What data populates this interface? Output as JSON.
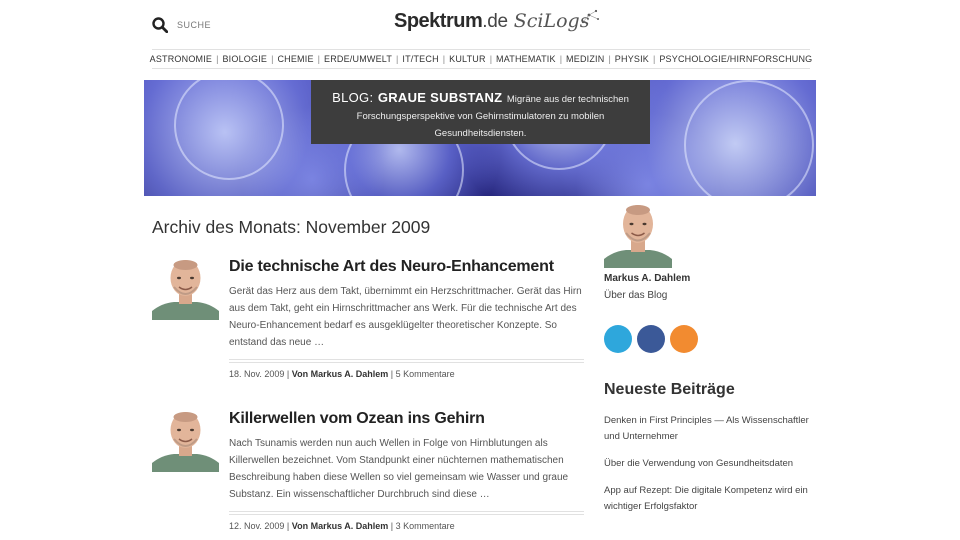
{
  "header": {
    "search_label": "SUCHE",
    "logo_main": "Spektrum",
    "logo_de": ".de",
    "logo_scilogs": "SciLogs"
  },
  "nav": {
    "items": [
      "ASTRONOMIE",
      "BIOLOGIE",
      "CHEMIE",
      "ERDE/UMWELT",
      "IT/TECH",
      "KULTUR",
      "MATHEMATIK",
      "MEDIZIN",
      "PHYSIK",
      "PSYCHOLOGIE/HIRNFORSCHUNG"
    ]
  },
  "banner": {
    "blog_label": "BLOG:",
    "blog_name": "GRAUE SUBSTANZ",
    "description_line1": "Migräne aus der technischen",
    "description_line2": "Forschungsperspektive von Gehirnstimulatoren zu mobilen",
    "description_line3": "Gesundheitsdiensten."
  },
  "main": {
    "archive_title": "Archiv des Monats: November 2009",
    "posts": [
      {
        "title": "Die technische Art des Neuro-Enhancement",
        "excerpt": "Gerät das Herz aus dem Takt, übernimmt ein Herzschrittmacher. Gerät das Hirn aus dem Takt, geht ein Hirnschrittmacher ans Werk. Für die technische Art des Neuro-Enhancement bedarf es ausgeklügelter theoretischer Konzepte. So entstand das neue …",
        "date": "18. Nov. 2009",
        "author": "Von Markus A. Dahlem",
        "comments": "5 Kommentare"
      },
      {
        "title": "Killerwellen vom Ozean ins Gehirn",
        "excerpt": "Nach Tsunamis werden nun auch Wellen in Folge von Hirnblutungen als Killerwellen bezeichnet. Vom Standpunkt einer nüchternen mathematischen Beschreibung haben diese Wellen so viel gemeinsam wie Wasser und graue Substanz. Ein wissenschaftlicher Durchbruch sind diese …",
        "date": "12. Nov. 2009",
        "author": "Von Markus A. Dahlem",
        "comments": "3 Kommentare"
      }
    ],
    "meta_separator": "|"
  },
  "sidebar": {
    "author_name": "Markus A. Dahlem",
    "about_link": "Über das Blog",
    "social": [
      {
        "icon": "twitter-icon",
        "color": "#2ea7dc"
      },
      {
        "icon": "facebook-icon",
        "color": "#3b5998"
      },
      {
        "icon": "rss-icon",
        "color": "#f28b30"
      }
    ],
    "recent_title": "Neueste Beiträge",
    "recent_posts": [
      "Denken in First Principles — Als Wissenschaftler und Unternehmer",
      "Über die Verwendung von Gesundheitsdaten",
      "App auf Rezept: Die digitale Kompetenz wird ein wichtiger Erfolgsfaktor"
    ]
  }
}
